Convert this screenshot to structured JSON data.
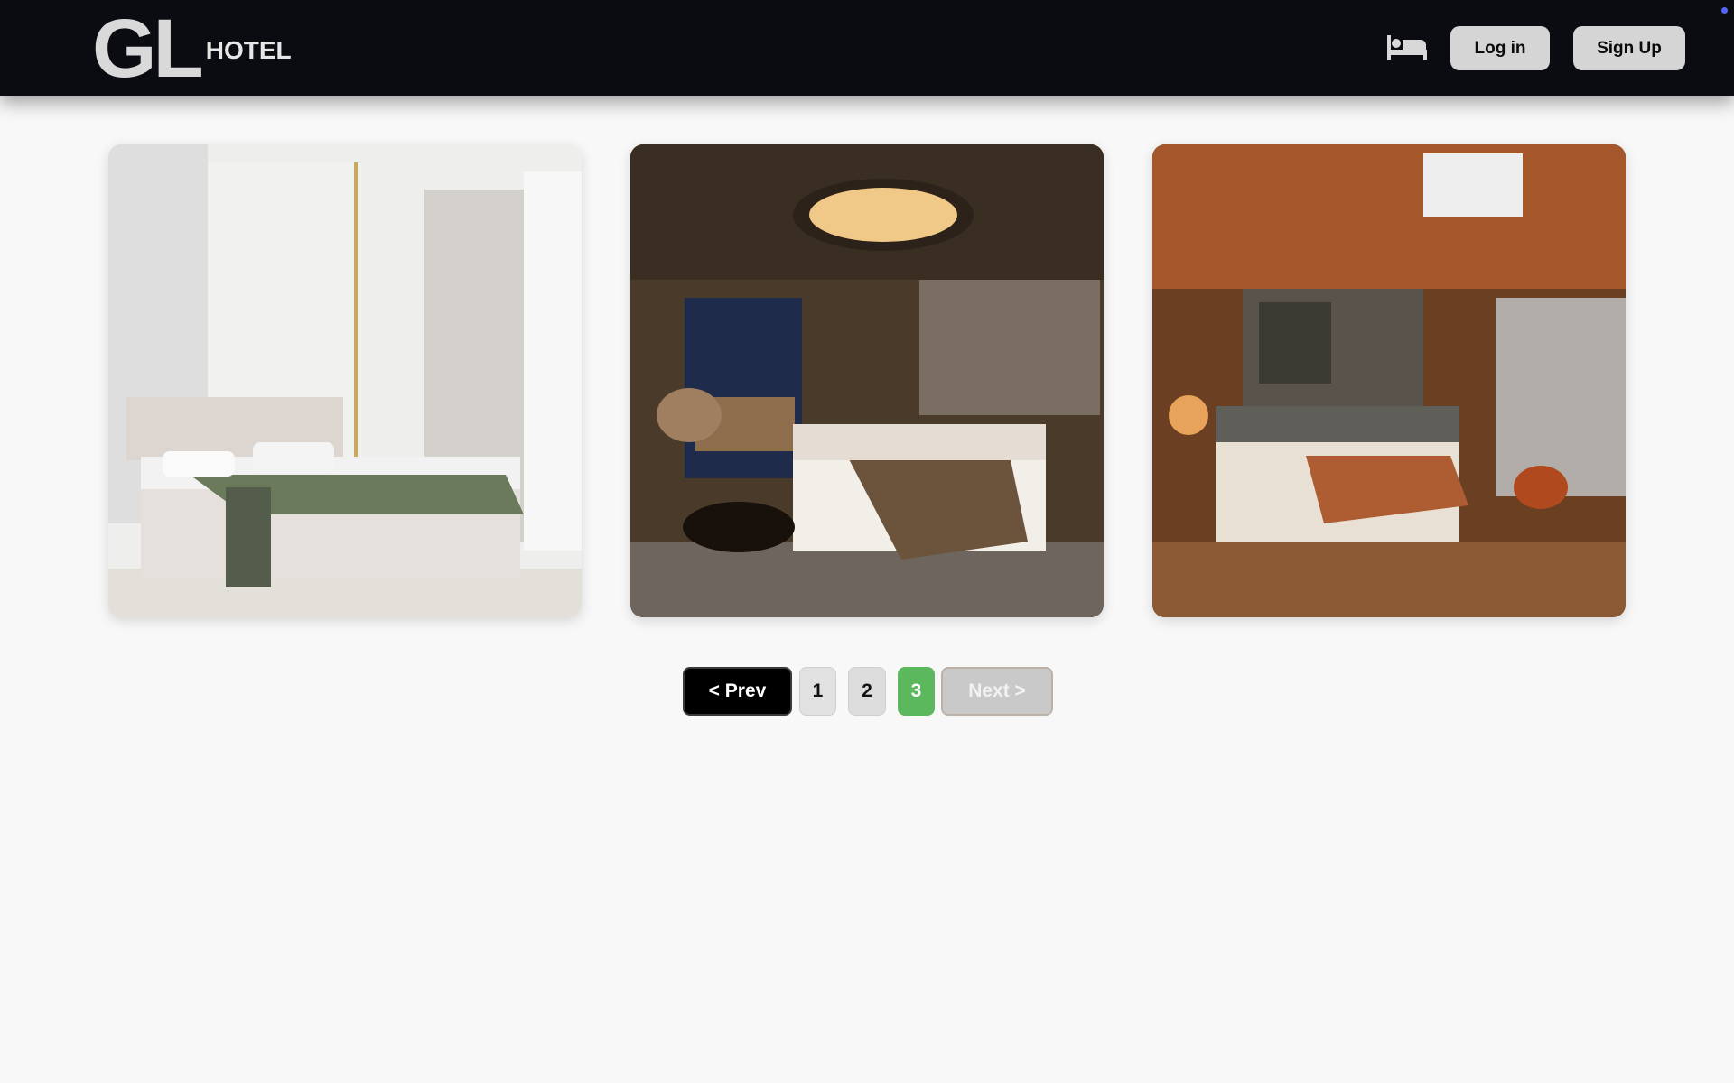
{
  "header": {
    "logo_letters": "GL",
    "logo_word": "HOTEL",
    "bed_icon": "bed-icon",
    "login_label": "Log in",
    "signup_label": "Sign Up"
  },
  "rooms": [
    {
      "image": "room-photo",
      "style": "bright white bedroom with green blanket"
    },
    {
      "image": "room-photo",
      "style": "luxury bedroom with city night view"
    },
    {
      "image": "room-photo",
      "style": "warm amber-lit bedroom with balcony"
    }
  ],
  "pagination": {
    "prev_label": "< Prev",
    "pages": [
      "1",
      "2",
      "3"
    ],
    "current_page": "3",
    "next_label": "Next >"
  },
  "colors": {
    "header_bg": "#0b0c12",
    "page_bg": "#f8f8f8",
    "active_page": "#5cb85c"
  }
}
